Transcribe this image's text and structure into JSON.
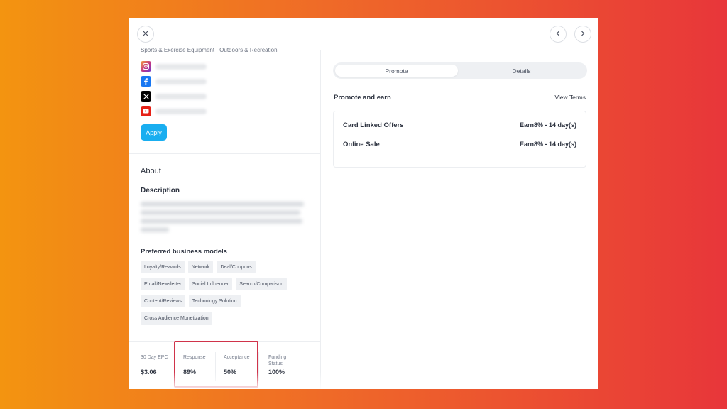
{
  "nav": {
    "close_icon": "close-icon",
    "prev_icon": "chevron-left-icon",
    "next_icon": "chevron-right-icon"
  },
  "profile": {
    "category": "Sports & Exercise Equipment · Outdoors & Recreation",
    "socials": [
      {
        "name": "instagram-icon",
        "color": "#c13584"
      },
      {
        "name": "facebook-icon",
        "color": "#1877f2"
      },
      {
        "name": "x-icon",
        "color": "#000000"
      },
      {
        "name": "youtube-icon",
        "color": "#e62117"
      }
    ],
    "apply_label": "Apply"
  },
  "about": {
    "title": "About",
    "description_title": "Description",
    "models_title": "Preferred business models",
    "models": [
      [
        "Loyalty/Rewards",
        "Network",
        "Deal/Coupons"
      ],
      [
        "Email/Newsletter",
        "Social Influencer",
        "Search/Comparison"
      ],
      [
        "Content/Reviews",
        "Technology Solution"
      ],
      [
        "Cross Audience Monetization"
      ]
    ]
  },
  "stats": [
    {
      "label": "30 Day EPC",
      "value": "$3.06"
    },
    {
      "label": "Response",
      "value": "89%"
    },
    {
      "label": "Acceptance",
      "value": "50%"
    },
    {
      "label": "Funding Status",
      "value": "100%"
    }
  ],
  "tabs": {
    "promote": "Promote",
    "details": "Details"
  },
  "promote": {
    "title": "Promote and earn",
    "view_terms": "View Terms",
    "offers": [
      {
        "name": "Card Linked Offers",
        "earn": "Earn8% - 14 day(s)"
      },
      {
        "name": "Online Sale",
        "earn": "Earn8% - 14 day(s)"
      }
    ]
  },
  "colors": {
    "accent": "#19aef0",
    "highlight": "#d0334a"
  }
}
